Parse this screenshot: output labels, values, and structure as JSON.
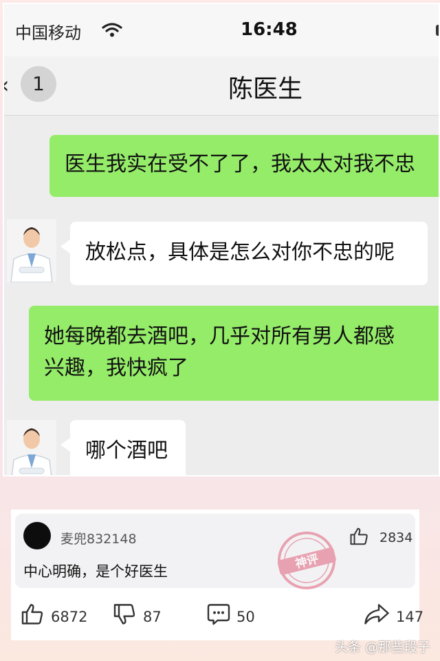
{
  "status_bar": {
    "carrier": "中国移动",
    "time": "16:48"
  },
  "chat_header": {
    "unread_count": "1",
    "title": "陈医生"
  },
  "messages": [
    {
      "side": "right",
      "text": "医生我实在受不了了，我太太对我不忠"
    },
    {
      "side": "left",
      "text": "放松点，具体是怎么对你不忠的呢"
    },
    {
      "side": "right",
      "lines": [
        "她每晚都去酒吧，几乎对所有男人都感",
        "兴趣，我快疯了"
      ]
    },
    {
      "side": "left",
      "text": "哪个酒吧"
    }
  ],
  "comment": {
    "username": "麦兜832148",
    "likes": "2834",
    "text": "中心明确，是个好医生",
    "stamp_text": "神评"
  },
  "post_actions": {
    "likes": "6872",
    "dislikes": "87",
    "comments": "50",
    "shares": "147"
  },
  "watermark": "头条 @那些段子",
  "colors": {
    "sent_bubble": "#95ec69",
    "received_bubble": "#ffffff",
    "chat_bg": "#ededed",
    "stamp": "#e0607a"
  }
}
